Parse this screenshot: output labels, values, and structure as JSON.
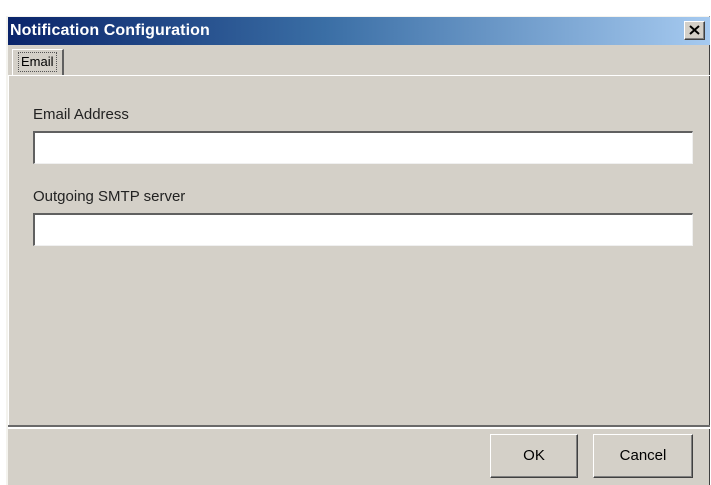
{
  "window": {
    "title": "Notification Configuration",
    "close_icon": "close-icon"
  },
  "tabs": [
    {
      "label": "Email",
      "selected": true
    }
  ],
  "form": {
    "email_label": "Email Address",
    "email_value": "",
    "smtp_label": "Outgoing SMTP server",
    "smtp_value": ""
  },
  "buttons": {
    "ok_label": "OK",
    "cancel_label": "Cancel"
  },
  "colors": {
    "title_start": "#0a246a",
    "title_end": "#a6caf0",
    "dialog_bg": "#d4d0c8"
  }
}
